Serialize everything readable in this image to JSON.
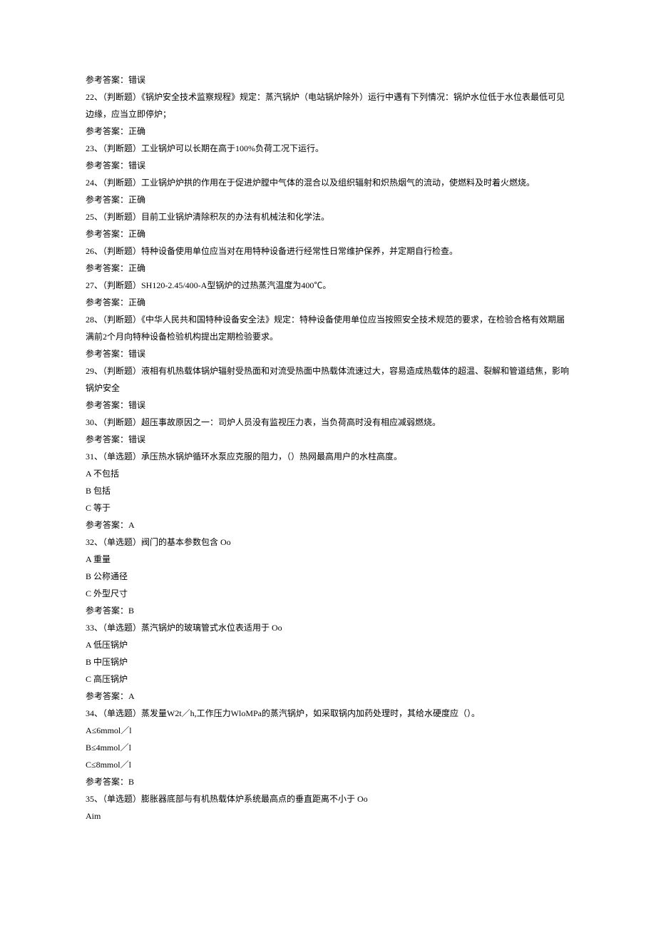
{
  "lines": [
    "参考答案：错误",
    "22、（判断题）《锅炉安全技术监察规程》规定：蒸汽锅炉（电站锅炉除外）运行中遇有下列情况：锅炉水位低于水位表最低可见边缘，应当立即停炉；",
    "参考答案：正确",
    "23、（判断题）工业锅炉可以长期在高于100%负荷工况下运行。",
    "参考答案：错误",
    "24、（判断题）工业锅炉炉拱的作用在于促进炉膛中气体的混合以及组织辐射和炽热烟气的流动，使燃料及时着火燃烧。",
    "参考答案：正确",
    "25、（判断题）目前工业锅炉清除积灰的办法有机械法和化学法。",
    "参考答案：正确",
    "26、（判断题）特种设备使用单位应当对在用特种设备进行经常性日常维护保养，并定期自行检查。",
    "参考答案：正确",
    "27、（判断题）SH120-2.45/400-A型锅炉的过热蒸汽温度为400℃。",
    "参考答案：正确",
    "28、（判断题）《中华人民共和国特种设备安全法》规定：特种设备使用单位应当按照安全技术规范的要求，在检验合格有效期届满前2个月向特种设备检验机构提出定期检验要求。",
    "参考答案：错误",
    "29、（判断题）液相有机热载体锅炉辐射受热面和对流受热面中热载体流速过大，容易造成热载体的超温、裂解和管道结焦，影响锅炉安全",
    "参考答案：错误",
    "30、（判断题）超压事故原因之一：司炉人员没有监视压力表，当负荷高时没有相应减弱燃烧。",
    "参考答案：错误",
    "31、（单选题）承压热水锅炉循环水泵应克服的阻力，（）热网最高用户的水柱高度。",
    "A 不包括",
    "B 包括",
    "C 等于",
    "参考答案：A",
    "32、（单选题）阀门的基本参数包含 Oo",
    "A 重量",
    "B 公称通径",
    "C 外型尺寸",
    "参考答案：B",
    "33、（单选题）蒸汽锅炉的玻璃管式水位表适用于 Oo",
    "A 低压锅炉",
    "B 中压锅炉",
    "C 高压锅炉",
    "参考答案：A",
    "34、（单选题）蒸发量W2t／h,工作压力WloMPa的蒸汽锅炉，如采取锅内加药处理时，其给水硬度应（）。",
    "A≤6mmol／l",
    "B≤4mmol／l",
    "C≤8mmol／l",
    "参考答案：B",
    "35、（单选题）膨胀器底部与有机热载体炉系统最高点的垂直距离不小于 Oo",
    "Aim"
  ]
}
